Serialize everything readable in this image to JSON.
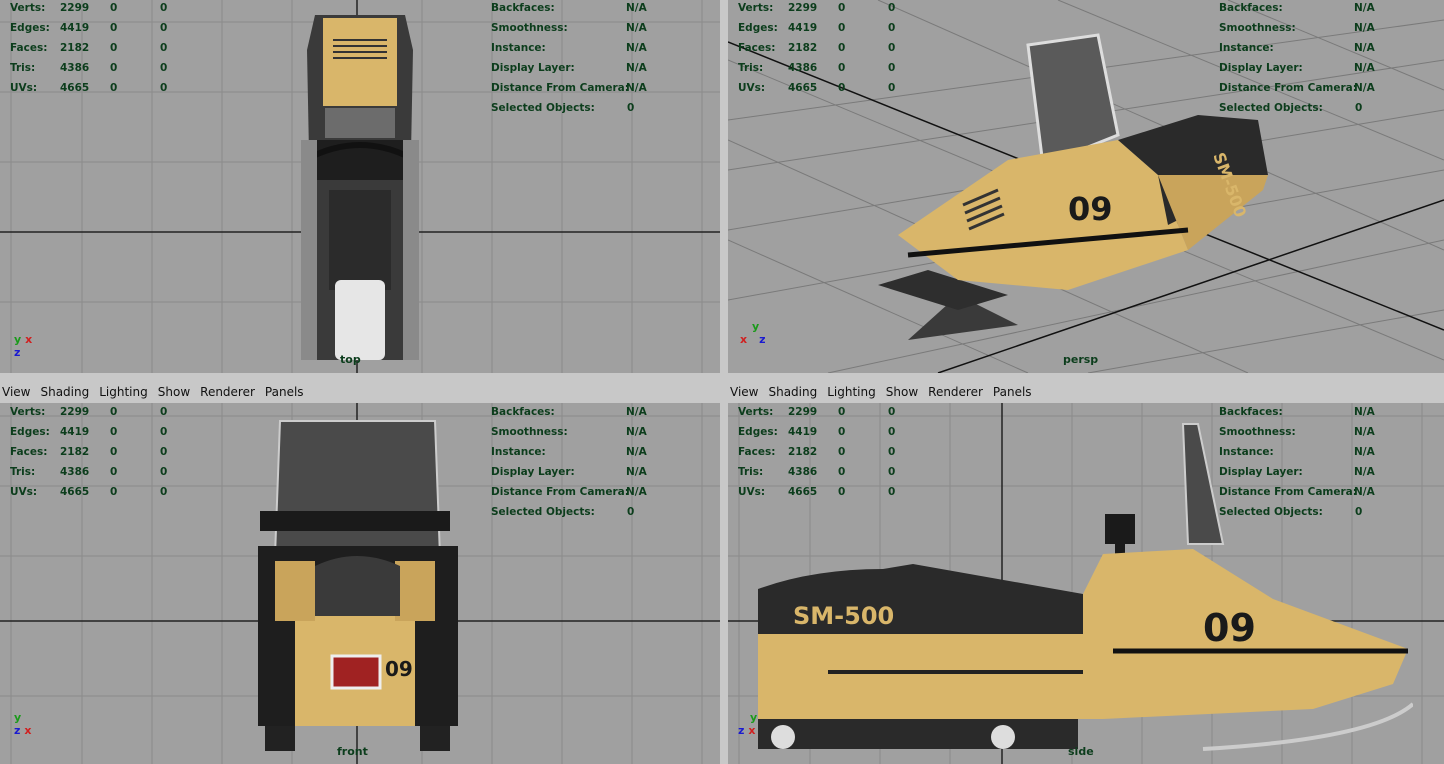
{
  "menus": [
    "View",
    "Shading",
    "Lighting",
    "Show",
    "Renderer",
    "Panels"
  ],
  "hud_left": {
    "rows": [
      {
        "label": "Verts:",
        "v1": "2299",
        "v2": "0",
        "v3": "0"
      },
      {
        "label": "Edges:",
        "v1": "4419",
        "v2": "0",
        "v3": "0"
      },
      {
        "label": "Faces:",
        "v1": "2182",
        "v2": "0",
        "v3": "0"
      },
      {
        "label": "Tris:",
        "v1": "4386",
        "v2": "0",
        "v3": "0"
      },
      {
        "label": "UVs:",
        "v1": "4665",
        "v2": "0",
        "v3": "0"
      }
    ]
  },
  "hud_right": {
    "rows": [
      {
        "label": "Backfaces:",
        "value": "N/A"
      },
      {
        "label": "Smoothness:",
        "value": "N/A"
      },
      {
        "label": "Instance:",
        "value": "N/A"
      },
      {
        "label": "Display Layer:",
        "value": "N/A"
      },
      {
        "label": "Distance From Camera:",
        "value": "N/A"
      },
      {
        "label": "Selected Objects:",
        "value": "0"
      }
    ]
  },
  "viewports": {
    "top": {
      "camera": "top"
    },
    "persp": {
      "camera": "persp"
    },
    "front": {
      "camera": "front"
    },
    "side": {
      "camera": "side"
    }
  },
  "model": {
    "number": "09",
    "name": "SM-500",
    "body_color": "#d9b66a",
    "dark_color": "#2a2a2a"
  },
  "axes": {
    "x": "x",
    "y": "y",
    "z": "z"
  }
}
